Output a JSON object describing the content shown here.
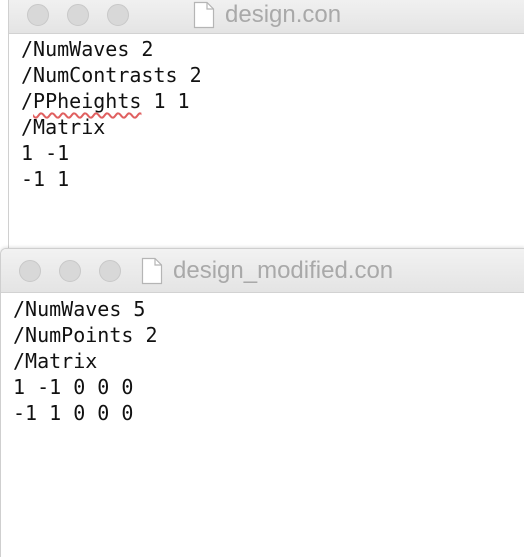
{
  "window1": {
    "title": "design.con",
    "lines": [
      {
        "parts": [
          {
            "text": "/NumWaves 2",
            "spell": false
          }
        ]
      },
      {
        "parts": [
          {
            "text": "/NumContrasts 2",
            "spell": false
          }
        ]
      },
      {
        "parts": [
          {
            "text": "/",
            "spell": false
          },
          {
            "text": "PPheights",
            "spell": true
          },
          {
            "text": " 1 1",
            "spell": false
          }
        ]
      },
      {
        "parts": [
          {
            "text": "/Matrix",
            "spell": false
          }
        ]
      },
      {
        "parts": [
          {
            "text": "1 -1",
            "spell": false
          }
        ]
      },
      {
        "parts": [
          {
            "text": "-1 1",
            "spell": false
          }
        ]
      }
    ]
  },
  "window2": {
    "title": "design_modified.con",
    "lines": [
      {
        "parts": [
          {
            "text": "/NumWaves 5",
            "spell": false
          }
        ]
      },
      {
        "parts": [
          {
            "text": "/NumPoints 2",
            "spell": false
          }
        ]
      },
      {
        "parts": [
          {
            "text": "/Matrix",
            "spell": false
          }
        ]
      },
      {
        "parts": [
          {
            "text": "1 -1 0 0 0",
            "spell": false
          }
        ]
      },
      {
        "parts": [
          {
            "text": "-1 1 0 0 0",
            "spell": false
          }
        ]
      }
    ]
  },
  "icons": {
    "close": "close-button-icon",
    "minimize": "minimize-button-icon",
    "zoom": "zoom-button-icon",
    "document": "document-icon"
  },
  "colors": {
    "title_text": "#a9a9a9",
    "traffic_inactive": "#d8d8d8",
    "spellcheck_underline": "#e06060"
  }
}
